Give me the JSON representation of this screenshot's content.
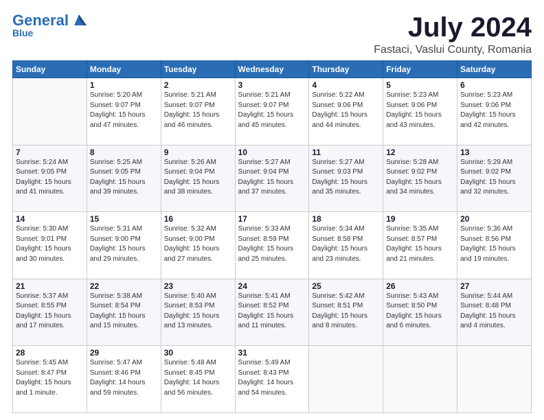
{
  "logo": {
    "general": "General",
    "blue": "Blue"
  },
  "header": {
    "month_year": "July 2024",
    "location": "Fastaci, Vaslui County, Romania"
  },
  "weekdays": [
    "Sunday",
    "Monday",
    "Tuesday",
    "Wednesday",
    "Thursday",
    "Friday",
    "Saturday"
  ],
  "weeks": [
    [
      {
        "day": "",
        "info": ""
      },
      {
        "day": "1",
        "info": "Sunrise: 5:20 AM\nSunset: 9:07 PM\nDaylight: 15 hours\nand 47 minutes."
      },
      {
        "day": "2",
        "info": "Sunrise: 5:21 AM\nSunset: 9:07 PM\nDaylight: 15 hours\nand 46 minutes."
      },
      {
        "day": "3",
        "info": "Sunrise: 5:21 AM\nSunset: 9:07 PM\nDaylight: 15 hours\nand 45 minutes."
      },
      {
        "day": "4",
        "info": "Sunrise: 5:22 AM\nSunset: 9:06 PM\nDaylight: 15 hours\nand 44 minutes."
      },
      {
        "day": "5",
        "info": "Sunrise: 5:23 AM\nSunset: 9:06 PM\nDaylight: 15 hours\nand 43 minutes."
      },
      {
        "day": "6",
        "info": "Sunrise: 5:23 AM\nSunset: 9:06 PM\nDaylight: 15 hours\nand 42 minutes."
      }
    ],
    [
      {
        "day": "7",
        "info": "Sunrise: 5:24 AM\nSunset: 9:05 PM\nDaylight: 15 hours\nand 41 minutes."
      },
      {
        "day": "8",
        "info": "Sunrise: 5:25 AM\nSunset: 9:05 PM\nDaylight: 15 hours\nand 39 minutes."
      },
      {
        "day": "9",
        "info": "Sunrise: 5:26 AM\nSunset: 9:04 PM\nDaylight: 15 hours\nand 38 minutes."
      },
      {
        "day": "10",
        "info": "Sunrise: 5:27 AM\nSunset: 9:04 PM\nDaylight: 15 hours\nand 37 minutes."
      },
      {
        "day": "11",
        "info": "Sunrise: 5:27 AM\nSunset: 9:03 PM\nDaylight: 15 hours\nand 35 minutes."
      },
      {
        "day": "12",
        "info": "Sunrise: 5:28 AM\nSunset: 9:02 PM\nDaylight: 15 hours\nand 34 minutes."
      },
      {
        "day": "13",
        "info": "Sunrise: 5:29 AM\nSunset: 9:02 PM\nDaylight: 15 hours\nand 32 minutes."
      }
    ],
    [
      {
        "day": "14",
        "info": "Sunrise: 5:30 AM\nSunset: 9:01 PM\nDaylight: 15 hours\nand 30 minutes."
      },
      {
        "day": "15",
        "info": "Sunrise: 5:31 AM\nSunset: 9:00 PM\nDaylight: 15 hours\nand 29 minutes."
      },
      {
        "day": "16",
        "info": "Sunrise: 5:32 AM\nSunset: 9:00 PM\nDaylight: 15 hours\nand 27 minutes."
      },
      {
        "day": "17",
        "info": "Sunrise: 5:33 AM\nSunset: 8:59 PM\nDaylight: 15 hours\nand 25 minutes."
      },
      {
        "day": "18",
        "info": "Sunrise: 5:34 AM\nSunset: 8:58 PM\nDaylight: 15 hours\nand 23 minutes."
      },
      {
        "day": "19",
        "info": "Sunrise: 5:35 AM\nSunset: 8:57 PM\nDaylight: 15 hours\nand 21 minutes."
      },
      {
        "day": "20",
        "info": "Sunrise: 5:36 AM\nSunset: 8:56 PM\nDaylight: 15 hours\nand 19 minutes."
      }
    ],
    [
      {
        "day": "21",
        "info": "Sunrise: 5:37 AM\nSunset: 8:55 PM\nDaylight: 15 hours\nand 17 minutes."
      },
      {
        "day": "22",
        "info": "Sunrise: 5:38 AM\nSunset: 8:54 PM\nDaylight: 15 hours\nand 15 minutes."
      },
      {
        "day": "23",
        "info": "Sunrise: 5:40 AM\nSunset: 8:53 PM\nDaylight: 15 hours\nand 13 minutes."
      },
      {
        "day": "24",
        "info": "Sunrise: 5:41 AM\nSunset: 8:52 PM\nDaylight: 15 hours\nand 11 minutes."
      },
      {
        "day": "25",
        "info": "Sunrise: 5:42 AM\nSunset: 8:51 PM\nDaylight: 15 hours\nand 8 minutes."
      },
      {
        "day": "26",
        "info": "Sunrise: 5:43 AM\nSunset: 8:50 PM\nDaylight: 15 hours\nand 6 minutes."
      },
      {
        "day": "27",
        "info": "Sunrise: 5:44 AM\nSunset: 8:48 PM\nDaylight: 15 hours\nand 4 minutes."
      }
    ],
    [
      {
        "day": "28",
        "info": "Sunrise: 5:45 AM\nSunset: 8:47 PM\nDaylight: 15 hours\nand 1 minute."
      },
      {
        "day": "29",
        "info": "Sunrise: 5:47 AM\nSunset: 8:46 PM\nDaylight: 14 hours\nand 59 minutes."
      },
      {
        "day": "30",
        "info": "Sunrise: 5:48 AM\nSunset: 8:45 PM\nDaylight: 14 hours\nand 56 minutes."
      },
      {
        "day": "31",
        "info": "Sunrise: 5:49 AM\nSunset: 8:43 PM\nDaylight: 14 hours\nand 54 minutes."
      },
      {
        "day": "",
        "info": ""
      },
      {
        "day": "",
        "info": ""
      },
      {
        "day": "",
        "info": ""
      }
    ]
  ]
}
